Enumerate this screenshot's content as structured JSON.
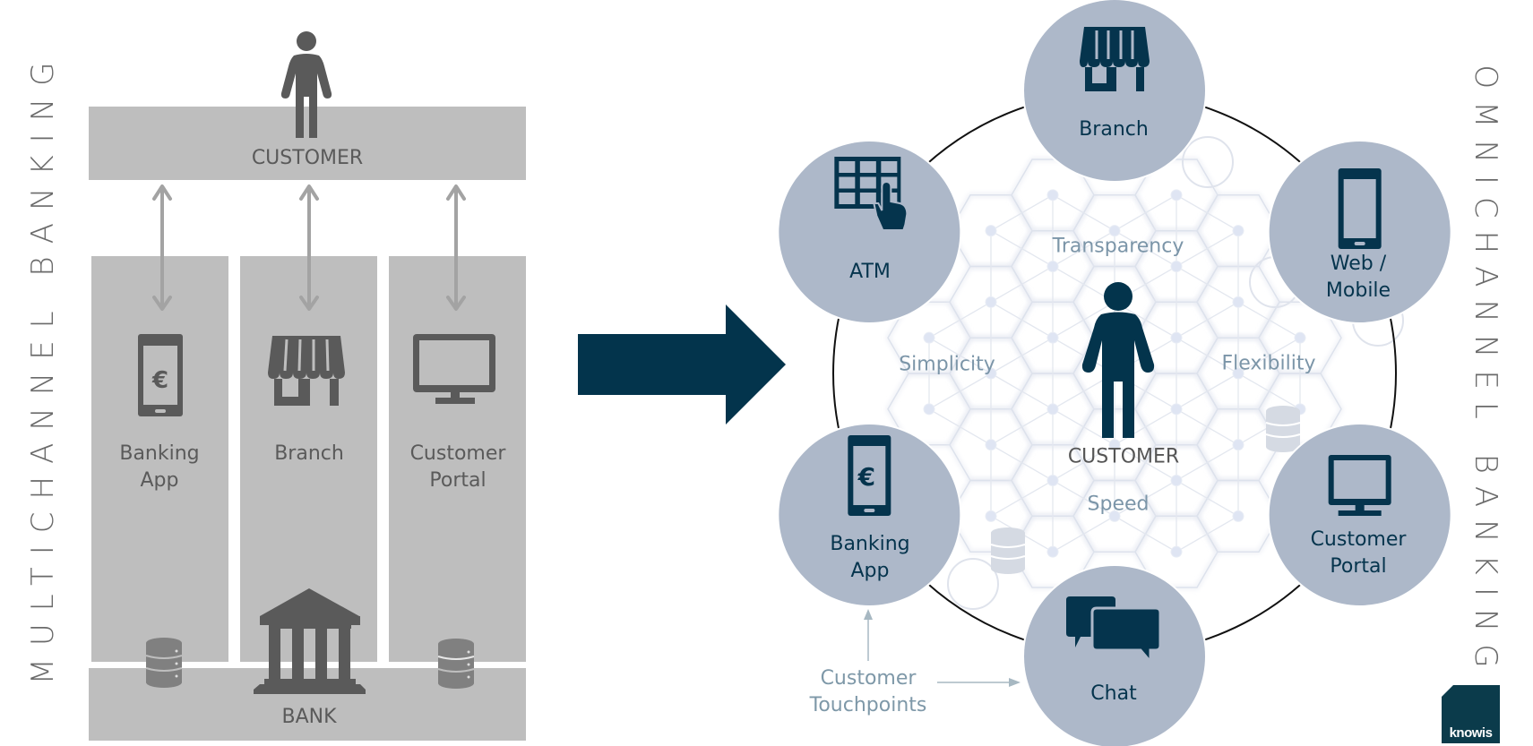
{
  "left_panel": {
    "title": "MULTICHANNEL BANKING",
    "customer_label": "CUSTOMER",
    "bank_label": "BANK",
    "channels": [
      {
        "line1": "Banking",
        "line2": "App",
        "icon": "mobile-euro-icon"
      },
      {
        "line1": "Branch",
        "line2": "",
        "icon": "storefront-icon"
      },
      {
        "line1": "Customer",
        "line2": "Portal",
        "icon": "monitor-icon"
      }
    ]
  },
  "right_panel": {
    "title": "OMNICHANNEL BANKING",
    "center_label": "CUSTOMER",
    "values": {
      "top": "Transparency",
      "left": "Simplicity",
      "right": "Flexibility",
      "bottom": "Speed"
    },
    "touchpoints": [
      {
        "line1": "Branch",
        "line2": "",
        "icon": "storefront-icon"
      },
      {
        "line1": "Web /",
        "line2": "Mobile",
        "icon": "smartphone-icon"
      },
      {
        "line1": "Customer",
        "line2": "Portal",
        "icon": "monitor-icon"
      },
      {
        "line1": "Chat",
        "line2": "",
        "icon": "chat-bubbles-icon"
      },
      {
        "line1": "Banking",
        "line2": "App",
        "icon": "mobile-euro-icon"
      },
      {
        "line1": "ATM",
        "line2": "",
        "icon": "atm-keypad-icon"
      }
    ],
    "touchpoints_caption": {
      "line1": "Customer",
      "line2": "Touchpoints"
    }
  },
  "logo": {
    "text": "knowis"
  },
  "colors": {
    "navy": "#05344d",
    "circle": "#adb8c9",
    "gray_panel": "#bebebe",
    "gray_icon": "#5a5a5a",
    "value_text": "#7b95a8"
  }
}
